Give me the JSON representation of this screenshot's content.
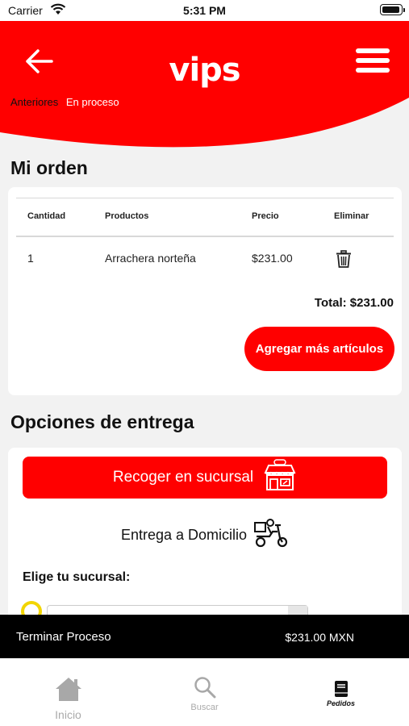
{
  "status_bar": {
    "carrier": "Carrier",
    "time": "5:31 PM"
  },
  "header": {
    "logo": "vips",
    "tabs": [
      {
        "label": "Anteriores"
      },
      {
        "label": "En proceso"
      }
    ]
  },
  "order": {
    "title": "Mi orden",
    "columns": [
      "Cantidad",
      "Productos",
      "Precio",
      "Eliminar"
    ],
    "rows": [
      {
        "quantity": "1",
        "product": "Arrachera norteña",
        "price": "$231.00"
      }
    ],
    "total": "Total: $231.00",
    "add_more_label": "Agregar más artículos"
  },
  "delivery": {
    "title": "Opciones de entrega",
    "pickup_label": "Recoger en sucursal",
    "home_delivery_label": "Entrega a Domicilio",
    "branch_label": "Elige tu sucursal:"
  },
  "finish": {
    "label": "Terminar Proceso",
    "amount": "$231.00 MXN"
  },
  "tabbar": {
    "items": [
      {
        "label": "Inicio"
      },
      {
        "label": "Buscar"
      },
      {
        "label": "Pedidos"
      }
    ]
  },
  "colors": {
    "accent": "#ff0000",
    "radio": "#f2d500",
    "bar": "#000000"
  }
}
